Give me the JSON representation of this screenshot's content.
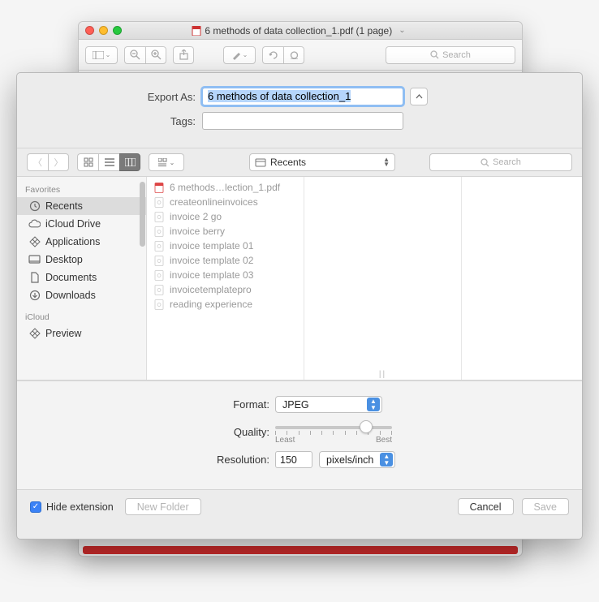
{
  "window": {
    "title": "6 methods of data collection_1.pdf (1 page)",
    "search_placeholder": "Search"
  },
  "sheet": {
    "export_as_label": "Export As:",
    "export_as_value": "6 methods of data collection_1",
    "tags_label": "Tags:",
    "tags_value": "",
    "location_value": "Recents",
    "search_placeholder": "Search"
  },
  "sidebar": {
    "favorites_header": "Favorites",
    "icloud_header": "iCloud",
    "favorites": [
      {
        "label": "Recents",
        "icon": "clock",
        "selected": true
      },
      {
        "label": "iCloud Drive",
        "icon": "cloud"
      },
      {
        "label": "Applications",
        "icon": "app"
      },
      {
        "label": "Desktop",
        "icon": "desktop"
      },
      {
        "label": "Documents",
        "icon": "doc"
      },
      {
        "label": "Downloads",
        "icon": "download"
      }
    ],
    "icloud": [
      {
        "label": "Preview",
        "icon": "app"
      }
    ]
  },
  "files": [
    {
      "name": "6 methods…lection_1.pdf",
      "type": "pdf"
    },
    {
      "name": "createonlineinvoices",
      "type": "page"
    },
    {
      "name": "invoice 2 go",
      "type": "page"
    },
    {
      "name": "invoice berry",
      "type": "page"
    },
    {
      "name": "invoice template 01",
      "type": "page"
    },
    {
      "name": "invoice template 02",
      "type": "page"
    },
    {
      "name": "invoice template 03",
      "type": "page"
    },
    {
      "name": "invoicetemplatepro",
      "type": "page"
    },
    {
      "name": "reading experience",
      "type": "page"
    }
  ],
  "options": {
    "format_label": "Format:",
    "format_value": "JPEG",
    "quality_label": "Quality:",
    "quality_least": "Least",
    "quality_best": "Best",
    "resolution_label": "Resolution:",
    "resolution_value": "150",
    "resolution_unit": "pixels/inch"
  },
  "footer": {
    "hide_ext_label": "Hide extension",
    "hide_ext_checked": true,
    "new_folder": "New Folder",
    "cancel": "Cancel",
    "save": "Save"
  }
}
